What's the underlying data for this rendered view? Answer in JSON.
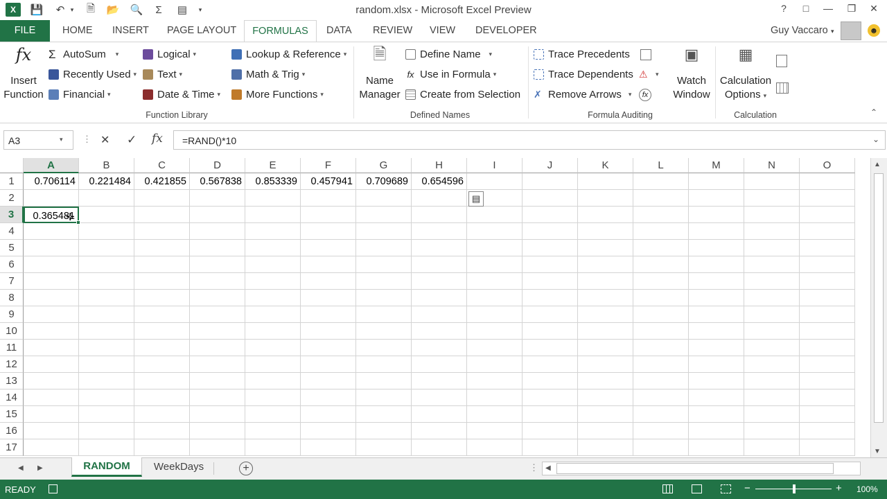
{
  "window": {
    "title": "random.xlsx - Microsoft Excel Preview",
    "help": "?",
    "user": "Guy Vaccaro"
  },
  "tabs": {
    "file": "FILE",
    "home": "HOME",
    "insert": "INSERT",
    "page_layout": "PAGE LAYOUT",
    "formulas": "FORMULAS",
    "data": "DATA",
    "review": "REVIEW",
    "view": "VIEW",
    "developer": "DEVELOPER"
  },
  "ribbon": {
    "insert_function": {
      "line1": "Insert",
      "line2": "Function"
    },
    "autosum": "AutoSum",
    "recently_used": "Recently Used",
    "financial": "Financial",
    "logical": "Logical",
    "text": "Text",
    "date_time": "Date & Time",
    "lookup": "Lookup & Reference",
    "math_trig": "Math & Trig",
    "more_functions": "More Functions",
    "function_library": "Function Library",
    "name_manager": {
      "line1": "Name",
      "line2": "Manager"
    },
    "define_name": "Define Name",
    "use_in_formula": "Use in Formula",
    "create_from_selection": "Create from Selection",
    "defined_names": "Defined Names",
    "trace_precedents": "Trace Precedents",
    "trace_dependents": "Trace Dependents",
    "remove_arrows": "Remove Arrows",
    "watch_window": {
      "line1": "Watch",
      "line2": "Window"
    },
    "formula_auditing": "Formula Auditing",
    "calc_options": {
      "line1": "Calculation",
      "line2": "Options"
    },
    "calculation": "Calculation"
  },
  "formula_bar": {
    "name_box": "A3",
    "formula": "=RAND()*10"
  },
  "grid": {
    "columns": [
      "A",
      "B",
      "C",
      "D",
      "E",
      "F",
      "G",
      "H",
      "I",
      "J",
      "K",
      "L",
      "M",
      "N",
      "O"
    ],
    "rows": [
      "1",
      "2",
      "3",
      "4",
      "5",
      "6",
      "7",
      "8",
      "9",
      "10",
      "11",
      "12",
      "13",
      "14",
      "15",
      "16",
      "17"
    ],
    "row1": [
      "0.706114",
      "0.221484",
      "0.421855",
      "0.567838",
      "0.853339",
      "0.457941",
      "0.709689",
      "0.654596"
    ],
    "a3": "0.365481"
  },
  "sheets": {
    "active": "RANDOM",
    "other": "WeekDays"
  },
  "status": {
    "mode": "READY",
    "zoom": "100%"
  },
  "colors": {
    "accent": "#217346"
  }
}
